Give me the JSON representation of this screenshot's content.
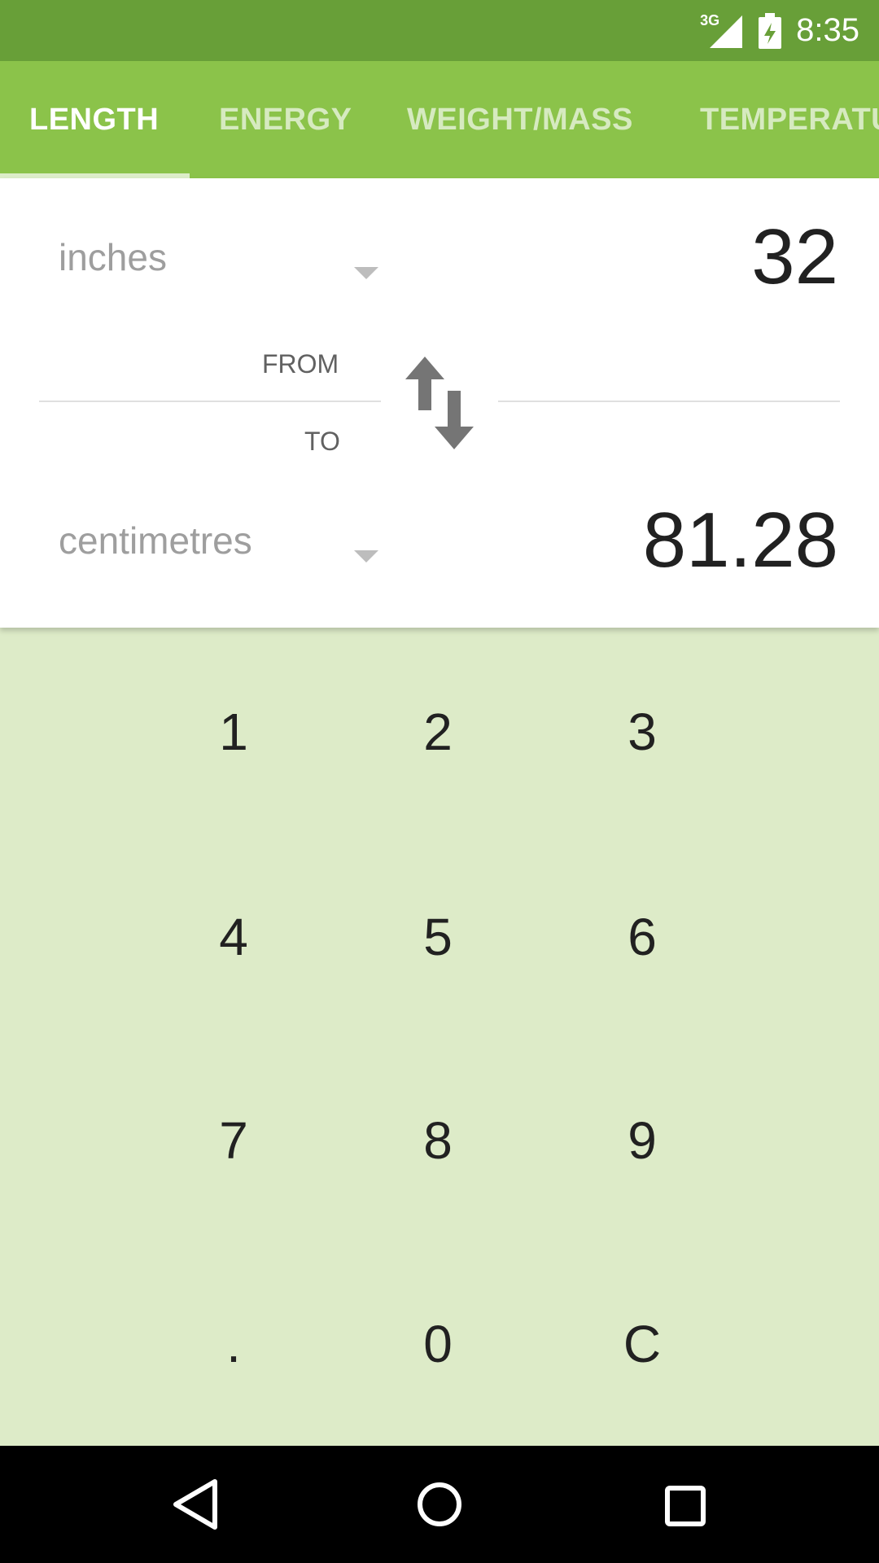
{
  "status_bar": {
    "network_label": "3G",
    "time": "8:35"
  },
  "tabs": [
    {
      "label": "LENGTH",
      "active": true
    },
    {
      "label": "ENERGY",
      "active": false
    },
    {
      "label": "WEIGHT/MASS",
      "active": false
    },
    {
      "label": "TEMPERATU",
      "active": false
    }
  ],
  "converter": {
    "from_unit": "inches",
    "from_value": "32",
    "from_label": "FROM",
    "to_label": "TO",
    "to_unit": "centimetres",
    "to_value": "81.28"
  },
  "keypad": {
    "keys": [
      "1",
      "2",
      "3",
      "4",
      "5",
      "6",
      "7",
      "8",
      "9",
      ".",
      "0",
      "C"
    ]
  },
  "colors": {
    "status_bar": "#689f38",
    "app_bar": "#8bc34a",
    "keypad_bg": "#ddebc8"
  },
  "icons": {
    "swap": "swap-vertical-icon",
    "back": "back-triangle-icon",
    "home": "home-circle-icon",
    "recents": "recents-square-icon"
  }
}
